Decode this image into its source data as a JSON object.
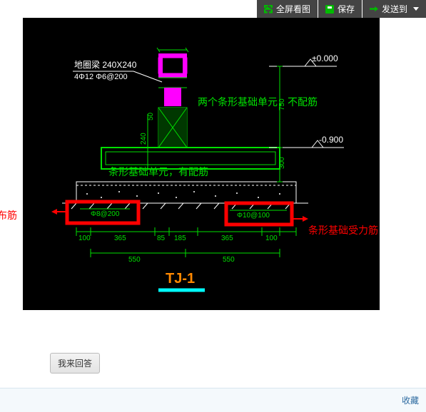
{
  "toolbar": {
    "fullscreen_label": "全屏看图",
    "save_label": "保存",
    "sendto_label": "发送到"
  },
  "drawing": {
    "beam_label_line1": "地圈梁 240X240",
    "beam_label_line2": "4Φ12 Φ6@200",
    "level_top": "±0.000",
    "level_bottom": "-0.900",
    "foundation_id": "TJ-1",
    "rebar_distribution": "Φ8@200",
    "rebar_main": "Φ10@100",
    "dims": {
      "h_col": "240",
      "h_col2": "50",
      "top_span_left": "100",
      "span_365_l": "365",
      "span_85": "85",
      "span_185": "185",
      "span_365_r": "365",
      "top_span_right": "100",
      "bottom_550_l": "550",
      "bottom_550_r": "550",
      "v_750": "750",
      "v_300": "300"
    }
  },
  "annotations": {
    "two_units_no_rebar": "两个条形基础单元，不配筋",
    "unit_with_rebar": "条形基础单元，有配筋",
    "distribution_rebar": "分布筋",
    "main_rebar": "条形基础受力筋"
  },
  "buttons": {
    "answer": "我来回答"
  },
  "footer": {
    "favorite": "收藏"
  }
}
